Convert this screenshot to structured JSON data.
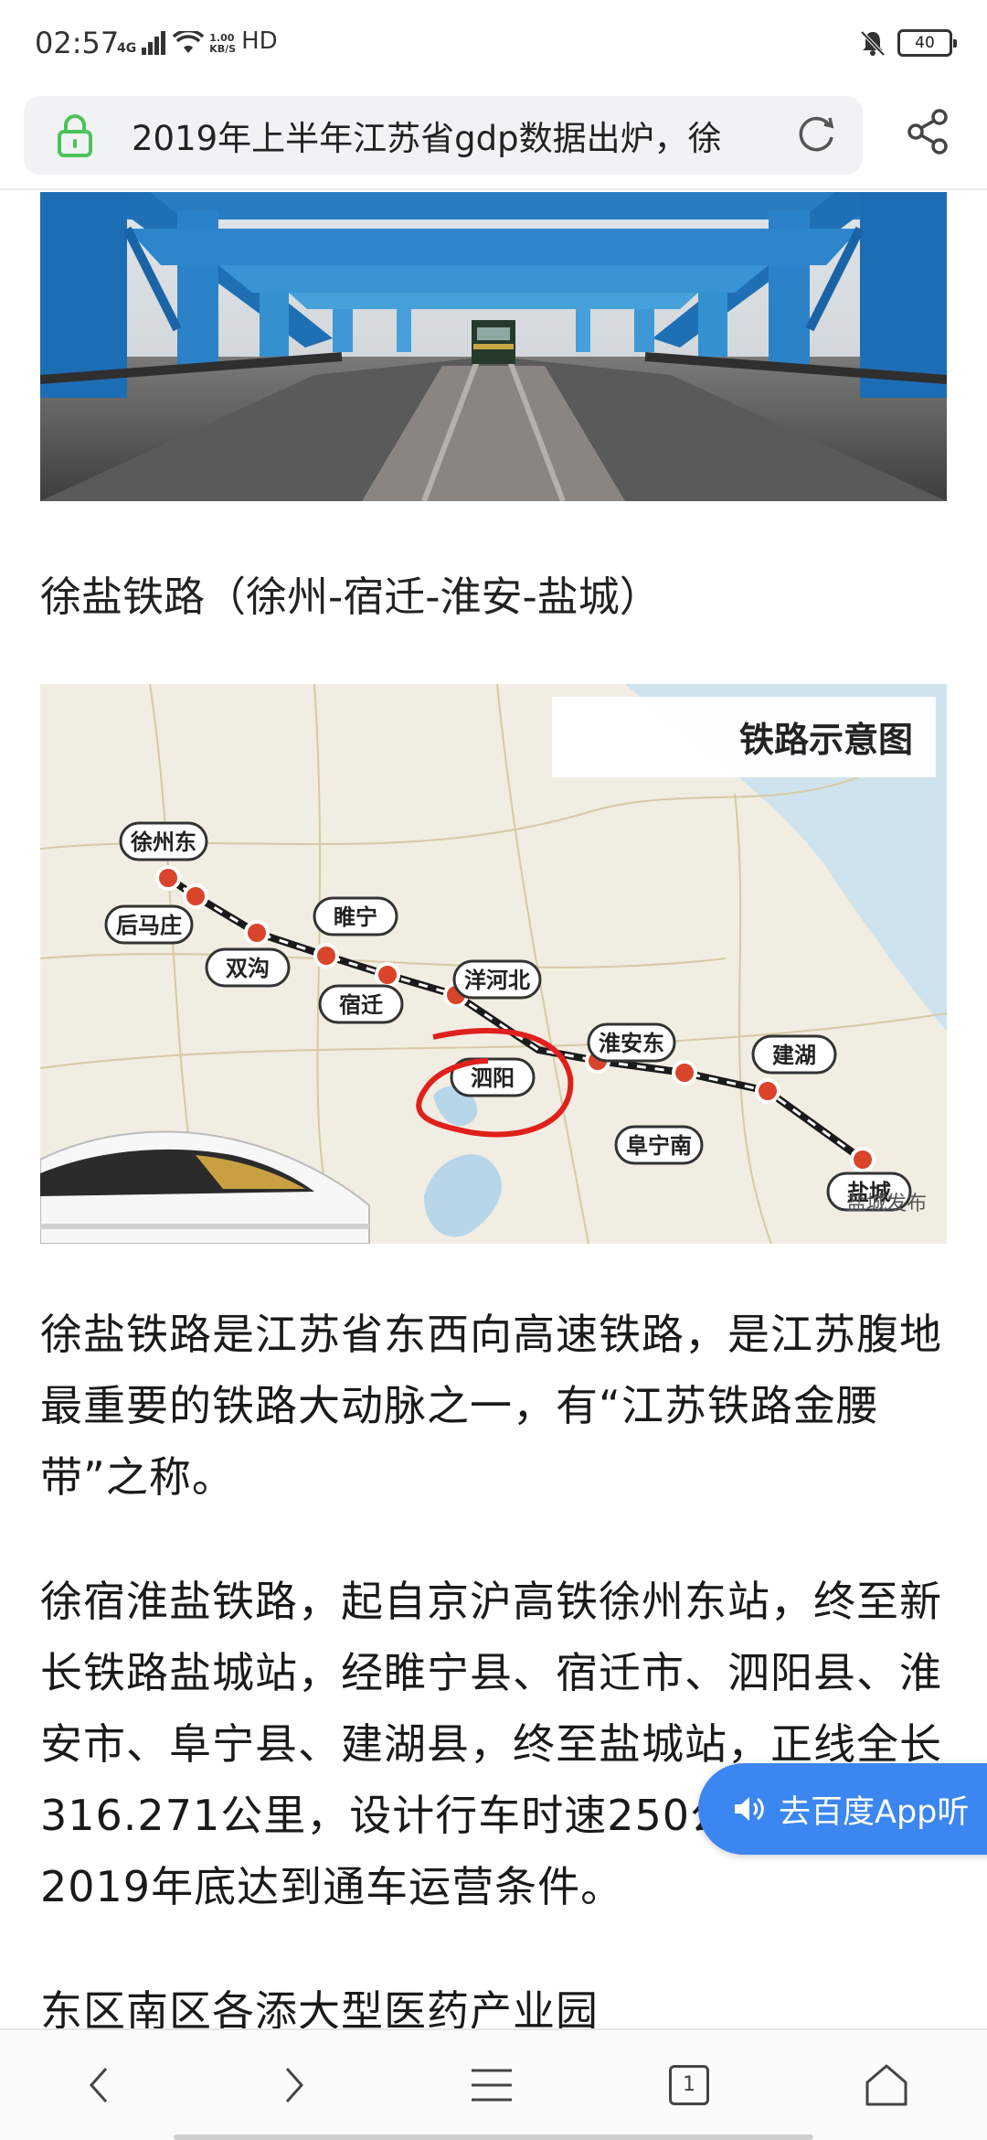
{
  "status_bar": {
    "time": "02:57",
    "network": "4G",
    "speed_value": "1.00",
    "speed_unit": "KB/S",
    "hd": "HD",
    "battery": "40"
  },
  "address_bar": {
    "title": "2019年上半年江苏省gdp数据出炉，徐"
  },
  "article": {
    "caption": "徐盐铁路（徐州-宿迁-淮安-盐城）",
    "map": {
      "title": "铁路示意图",
      "watermark": "盐城发布",
      "stations": [
        "徐州东",
        "后马庄",
        "睢宁",
        "双沟",
        "宿迁",
        "洋河北",
        "泗阳",
        "淮安东",
        "阜宁南",
        "建湖",
        "盐城"
      ]
    },
    "paragraph1": "徐盐铁路是江苏省东西向高速铁路，是江苏腹地最重要的铁路大动脉之一，有“江苏铁路金腰带”之称。",
    "paragraph2": "徐宿淮盐铁路，起自京沪高铁徐州东站，终至新长铁路盐城站，经睢宁县、宿迁市、泗阳县、淮安市、阜宁县、建湖县，终至盐城站，正线全长316.271公里，设计行车时速250公里，预计2019年底达到通车运营条件。",
    "paragraph3": "东区南区各添大型医药产业园"
  },
  "listen_button": {
    "label": "去百度App听"
  },
  "bottom_nav": {
    "tab_count": "1"
  },
  "colors": {
    "accent": "#3b86f0",
    "lock_green": "#4cc35a",
    "route_red": "#d9442b"
  }
}
